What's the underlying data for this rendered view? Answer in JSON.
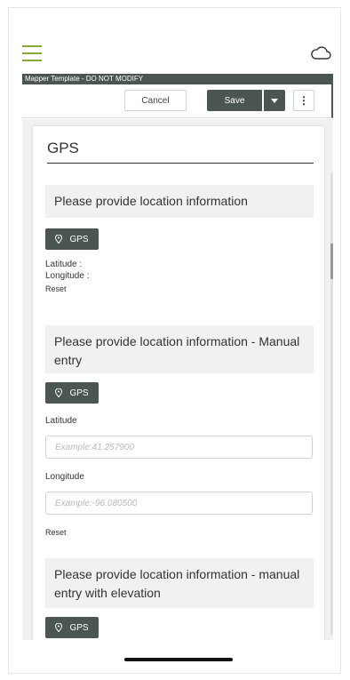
{
  "app": {
    "template_title": "Mapper Template - DO NOT MODIFY"
  },
  "toolbar": {
    "cancel_label": "Cancel",
    "save_label": "Save"
  },
  "form": {
    "section_title": "GPS",
    "q1": {
      "prompt": "Please provide location information",
      "gps_label": "GPS",
      "latitude_text": "Latitude :",
      "longitude_text": "Longitude :",
      "reset_label": "Reset"
    },
    "q2": {
      "prompt": "Please provide location information - Manual entry",
      "gps_label": "GPS",
      "latitude_label": "Latitude",
      "latitude_placeholder": "Example:41.257900",
      "longitude_label": "Longitude",
      "longitude_placeholder": "Example:-96.080500",
      "reset_label": "Reset"
    },
    "q3": {
      "prompt": "Please provide location information - manual entry with elevation",
      "gps_label": "GPS"
    }
  },
  "colors": {
    "accent_green": "#7fae33",
    "dark_gray": "#4b5552"
  }
}
